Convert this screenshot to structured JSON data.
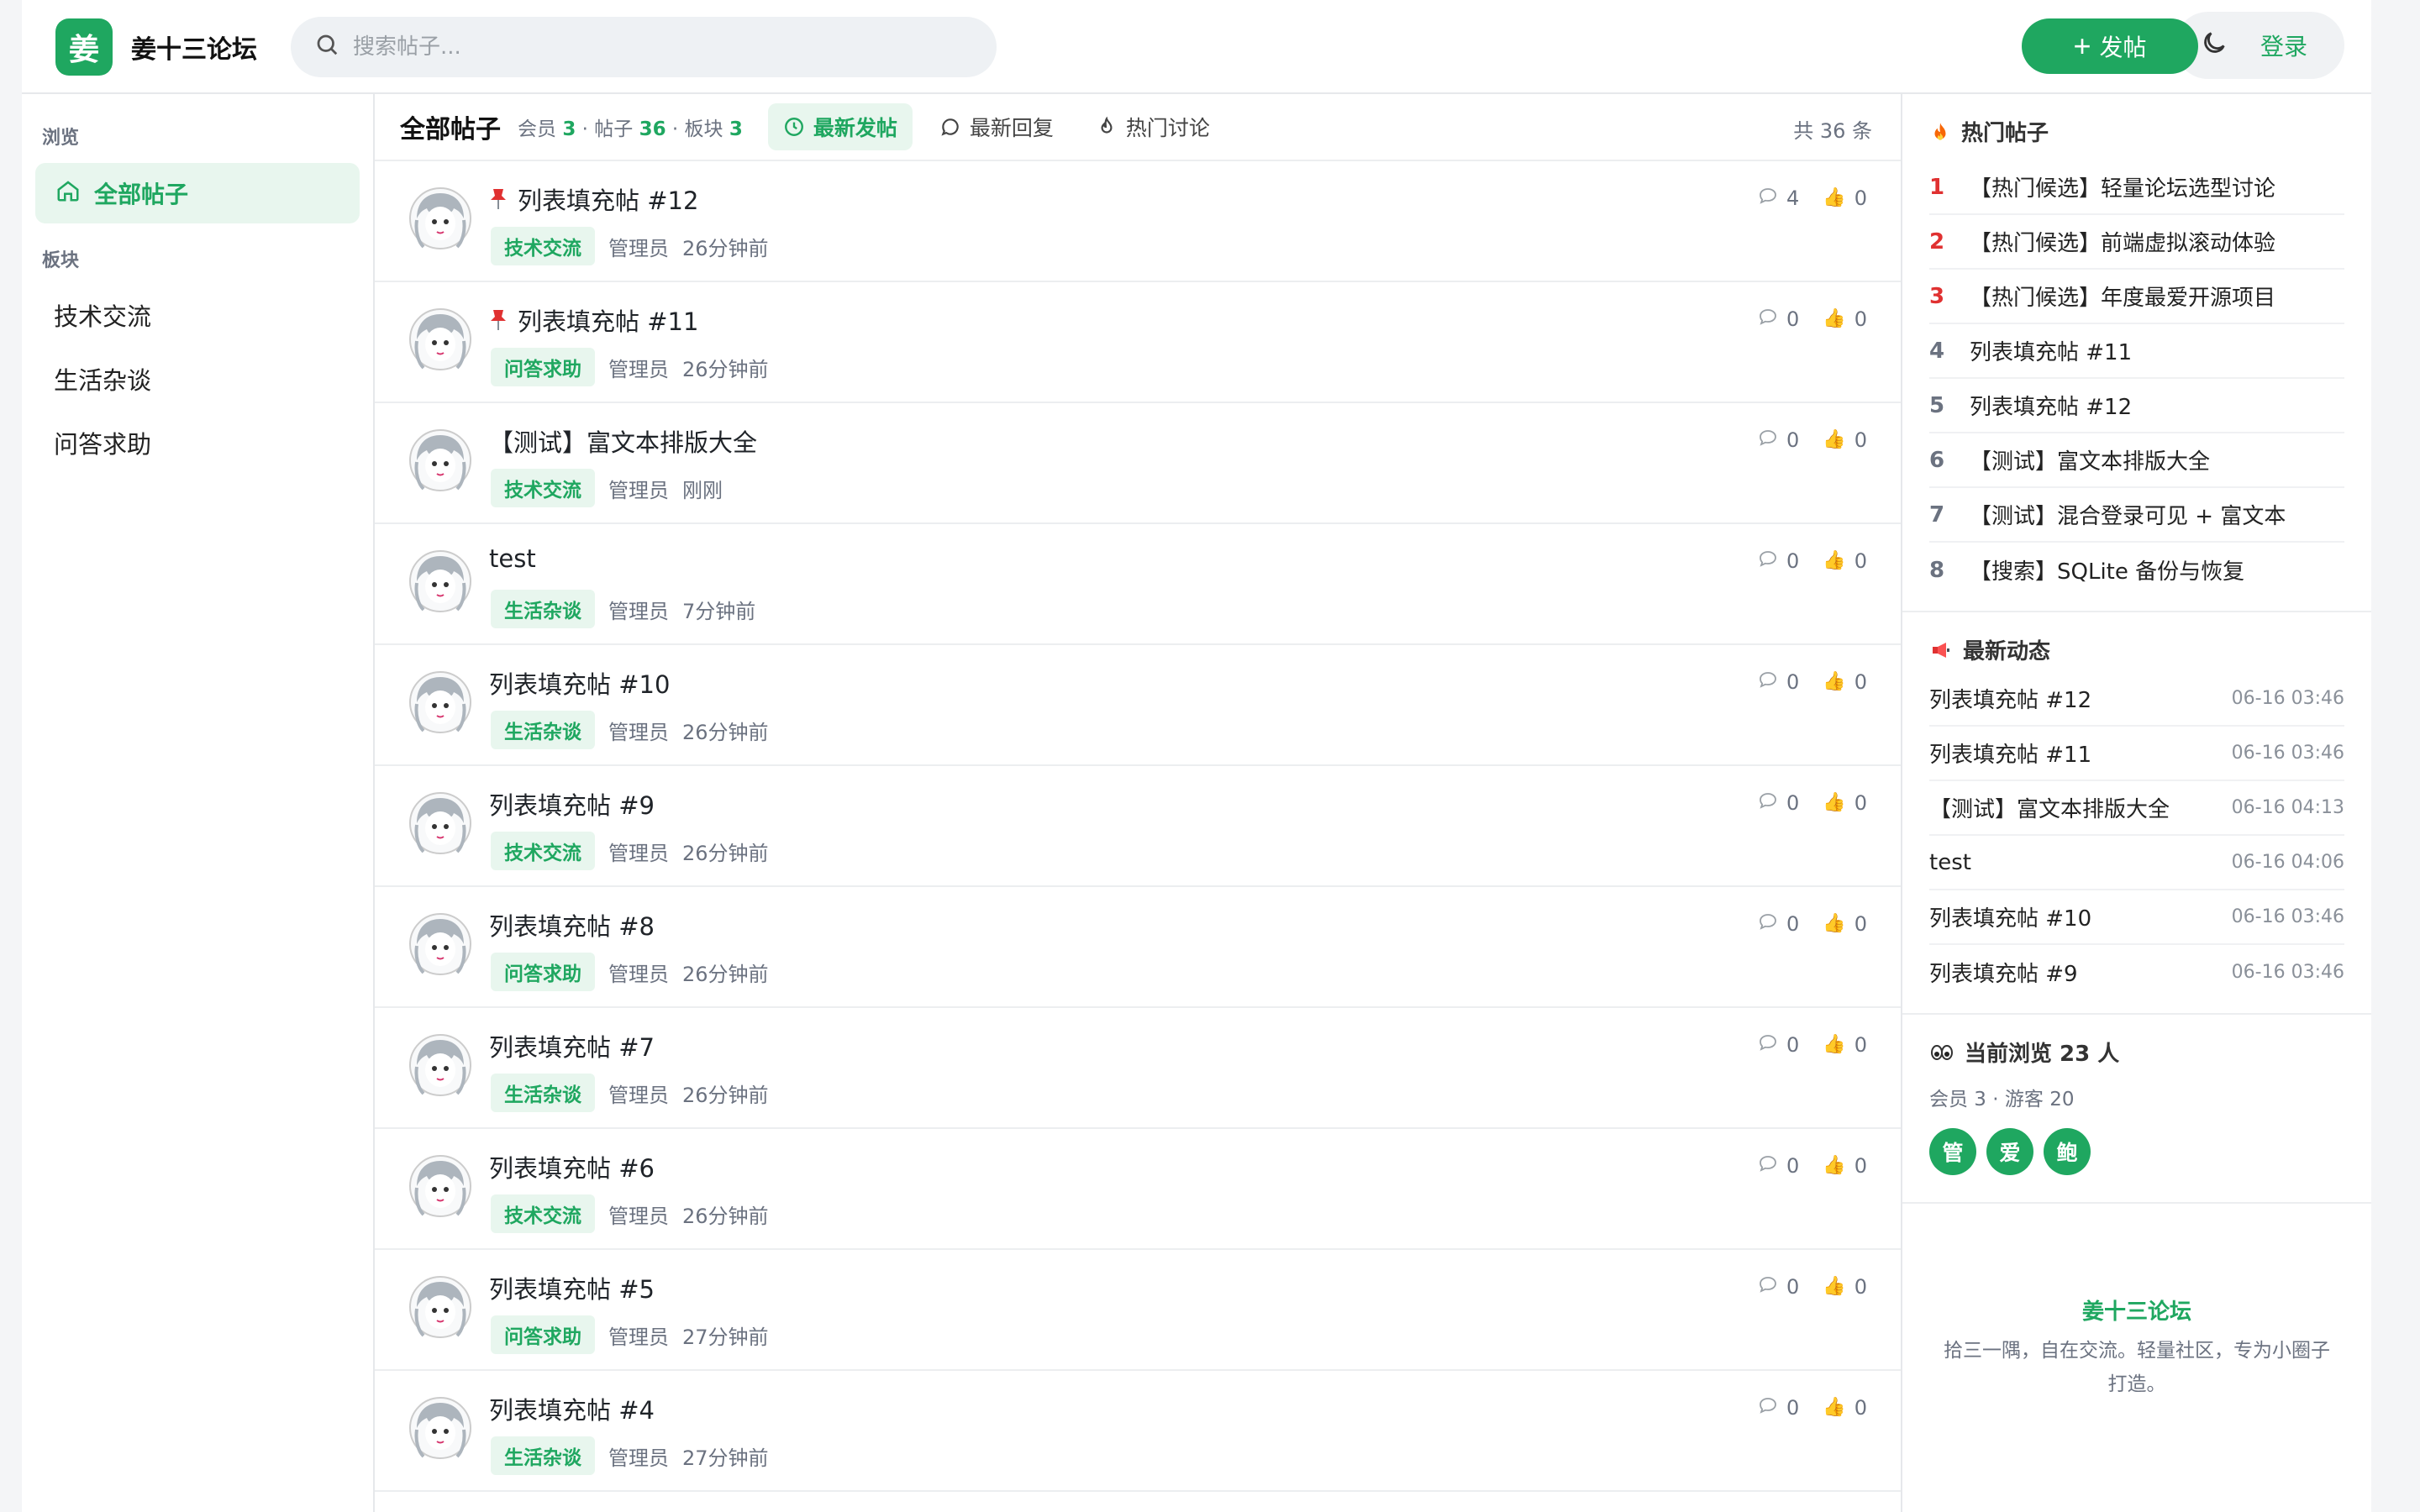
{
  "header": {
    "logo_char": "姜",
    "site_name": "姜十三论坛",
    "search_placeholder": "搜索帖子...",
    "post_button": "发帖",
    "login": "登录"
  },
  "sidebar": {
    "browse_label": "浏览",
    "all_posts": "全部帖子",
    "boards_label": "板块",
    "boards": [
      "技术交流",
      "生活杂谈",
      "问答求助"
    ]
  },
  "main": {
    "title": "全部帖子",
    "stats": {
      "members_label": "会员",
      "members": "3",
      "posts_label": "帖子",
      "posts": "36",
      "boards_label": "板块",
      "boards": "3"
    },
    "tabs": [
      "最新发帖",
      "最新回复",
      "热门讨论"
    ],
    "total": "共 36 条",
    "posts": [
      {
        "title": "列表填充帖 #12",
        "pinned": true,
        "tag": "技术交流",
        "author": "管理员",
        "time": "26分钟前",
        "comments": "4",
        "likes": "0"
      },
      {
        "title": "列表填充帖 #11",
        "pinned": true,
        "tag": "问答求助",
        "author": "管理员",
        "time": "26分钟前",
        "comments": "0",
        "likes": "0"
      },
      {
        "title": "【测试】富文本排版大全",
        "pinned": false,
        "tag": "技术交流",
        "author": "管理员",
        "time": "刚刚",
        "comments": "0",
        "likes": "0"
      },
      {
        "title": "test",
        "pinned": false,
        "tag": "生活杂谈",
        "author": "管理员",
        "time": "7分钟前",
        "comments": "0",
        "likes": "0"
      },
      {
        "title": "列表填充帖 #10",
        "pinned": false,
        "tag": "生活杂谈",
        "author": "管理员",
        "time": "26分钟前",
        "comments": "0",
        "likes": "0"
      },
      {
        "title": "列表填充帖 #9",
        "pinned": false,
        "tag": "技术交流",
        "author": "管理员",
        "time": "26分钟前",
        "comments": "0",
        "likes": "0"
      },
      {
        "title": "列表填充帖 #8",
        "pinned": false,
        "tag": "问答求助",
        "author": "管理员",
        "time": "26分钟前",
        "comments": "0",
        "likes": "0"
      },
      {
        "title": "列表填充帖 #7",
        "pinned": false,
        "tag": "生活杂谈",
        "author": "管理员",
        "time": "26分钟前",
        "comments": "0",
        "likes": "0"
      },
      {
        "title": "列表填充帖 #6",
        "pinned": false,
        "tag": "技术交流",
        "author": "管理员",
        "time": "26分钟前",
        "comments": "0",
        "likes": "0"
      },
      {
        "title": "列表填充帖 #5",
        "pinned": false,
        "tag": "问答求助",
        "author": "管理员",
        "time": "27分钟前",
        "comments": "0",
        "likes": "0"
      },
      {
        "title": "列表填充帖 #4",
        "pinned": false,
        "tag": "生活杂谈",
        "author": "管理员",
        "time": "27分钟前",
        "comments": "0",
        "likes": "0"
      }
    ]
  },
  "right": {
    "hot_title": "热门帖子",
    "hot": [
      {
        "rank": "1",
        "title": "【热门候选】轻量论坛选型讨论"
      },
      {
        "rank": "2",
        "title": "【热门候选】前端虚拟滚动体验"
      },
      {
        "rank": "3",
        "title": "【热门候选】年度最爱开源项目"
      },
      {
        "rank": "4",
        "title": "列表填充帖 #11"
      },
      {
        "rank": "5",
        "title": "列表填充帖 #12"
      },
      {
        "rank": "6",
        "title": "【测试】富文本排版大全"
      },
      {
        "rank": "7",
        "title": "【测试】混合登录可见 + 富文本"
      },
      {
        "rank": "8",
        "title": "【搜索】SQLite 备份与恢复"
      }
    ],
    "recent_title": "最新动态",
    "recent": [
      {
        "title": "列表填充帖 #12",
        "time": "06-16 03:46"
      },
      {
        "title": "列表填充帖 #11",
        "time": "06-16 03:46"
      },
      {
        "title": "【测试】富文本排版大全",
        "time": "06-16 04:13"
      },
      {
        "title": "test",
        "time": "06-16 04:06"
      },
      {
        "title": "列表填充帖 #10",
        "time": "06-16 03:46"
      },
      {
        "title": "列表填充帖 #9",
        "time": "06-16 03:46"
      }
    ],
    "online_title": "当前浏览 23 人",
    "online_sub": "会员 3 · 游客 20",
    "online_badges": [
      "管",
      "爱",
      "鲍"
    ],
    "footer_name": "姜十三论坛",
    "footer_desc": "拾三一隅，自在交流。轻量社区，专为小圈子打造。"
  },
  "colors": {
    "accent": "#1fa760",
    "accent_bg": "#e8f6ee",
    "hot_rank": "#e03131"
  }
}
